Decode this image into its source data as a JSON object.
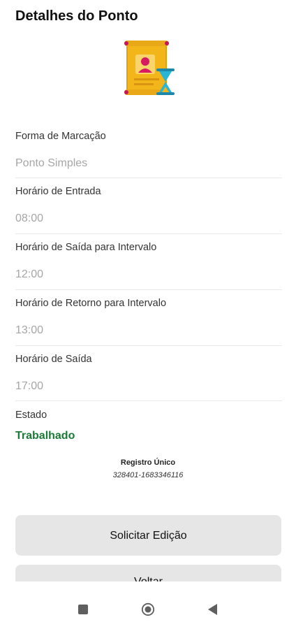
{
  "header": {
    "title": "Detalhes do Ponto"
  },
  "illustration": {
    "icon": "timecard-hourglass-icon"
  },
  "fields": [
    {
      "label": "Forma de Marcação",
      "value": "Ponto Simples"
    },
    {
      "label": "Horário de Entrada",
      "value": "08:00"
    },
    {
      "label": "Horário de Saída para Intervalo",
      "value": "12:00"
    },
    {
      "label": "Horário de Retorno para Intervalo",
      "value": "13:00"
    },
    {
      "label": "Horário de Saída",
      "value": "17:00"
    }
  ],
  "status": {
    "label": "Estado",
    "value": "Trabalhado",
    "color": "#1a7a36"
  },
  "registro": {
    "label": "Registro Único",
    "value": "328401-1683346116"
  },
  "buttons": {
    "edit_label": "Solicitar Edição",
    "back_label": "Voltar"
  },
  "colors": {
    "button_bg": "#e6e6e6",
    "placeholder_gray": "#a6a6a6"
  },
  "navbar": {
    "recent_icon": "square-icon",
    "home_icon": "circle-icon",
    "back_icon": "triangle-back-icon"
  }
}
